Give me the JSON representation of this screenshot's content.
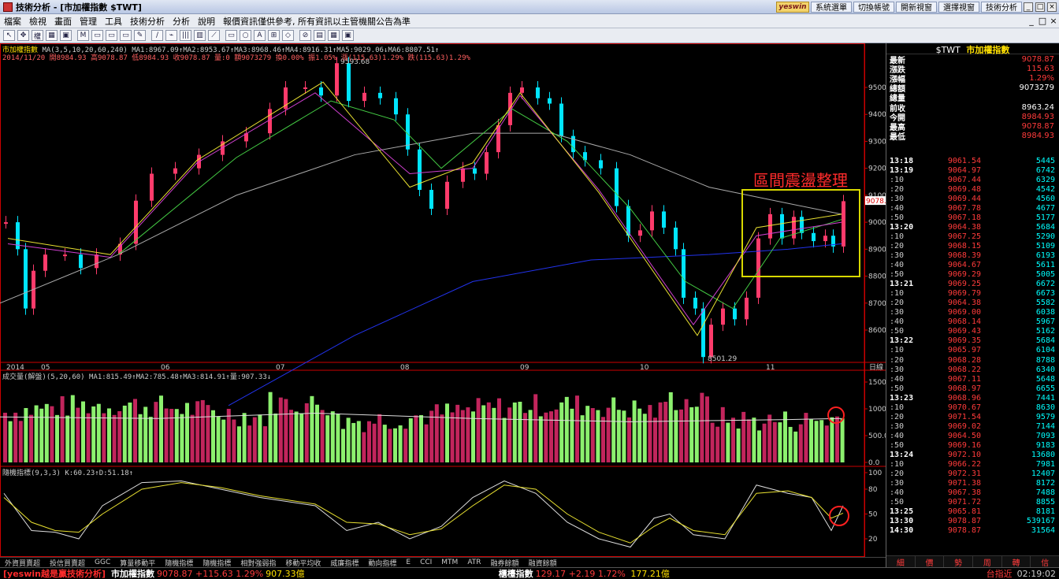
{
  "window": {
    "title": "技術分析 - [市加權指數 $TWT]",
    "brand": "yeswin",
    "top_buttons": [
      "系統選單",
      "切換帳號",
      "開新視窗",
      "選擇視窗",
      "技術分析"
    ],
    "controls": [
      "_",
      "□",
      "×"
    ]
  },
  "menu": {
    "items": [
      "檔案",
      "檢視",
      "畫面",
      "管理",
      "工具",
      "技術分析",
      "分析",
      "說明",
      "報價資訊僅供參考, 所有資訊以主管機關公告為準"
    ],
    "right_controls": [
      "_",
      "□",
      "×"
    ]
  },
  "toolbar": {
    "buttons": [
      "↖",
      "✥",
      "權",
      "▦",
      "▣",
      "M",
      "▭",
      "▭",
      "▭",
      "✎",
      "∕",
      "⌁",
      "|||",
      "▥",
      "⟋",
      "▭",
      "○",
      "A",
      "⊞",
      "◇",
      "⊘",
      "▤",
      "▦",
      "▣"
    ]
  },
  "chart": {
    "symbol_label": "市加權指數",
    "ma_line": "MA(3,5,10,20,60,240) MA1:8967.09↑MA2:8953.67↑MA3:8968.46↑MA4:8916.31↑MA5:9029.06↓MA6:8807.51↑",
    "ohlc_line": "2014/11/20 開8984.93 高9078.87 低8984.93 收9078.87 量:0 額9073279 換0.00% 振1.05% 漲(115.63)1.29% 跌(115.63)1.29%",
    "high_label": "9593.68",
    "low_label": "8501.29",
    "last_price_tag": "9078.9",
    "annotation": "區間震盪整理",
    "volume_legend": "成交量(解盤)(5,20,60) MA1:815.49↑MA2:785.48↑MA3:814.91↑量:907.33↓",
    "kd_legend": "隨機指標(9,3,3) K:60.23↑D:51.18↑",
    "price_axis": [
      "9500.0",
      "9400.0",
      "9300.0",
      "9200.0",
      "9100.0",
      "9000.0",
      "8900.0",
      "8800.0",
      "8700.0",
      "8600.0"
    ],
    "date_axis": [
      "2014",
      "05",
      "06",
      "07",
      "08",
      "09",
      "10",
      "11"
    ],
    "date_axis_right": "日線",
    "volume_axis": [
      "1500.0",
      "1000.0",
      "500.0",
      "0.0"
    ],
    "kd_axis": [
      "100",
      "80",
      "50",
      "20"
    ],
    "colors": {
      "up": "#ff3b6b",
      "down": "#00e5ff",
      "vol_up": "#c2255c",
      "vol_down": "#8cf06e",
      "ma_240": "#2233ee",
      "ma_60": "#aaaaaa",
      "box": "#d8d800",
      "mark": "#ff2020"
    }
  },
  "bottom_tabs": [
    "外資買賣超",
    "投信買賣超",
    "GGC",
    "算量移動平",
    "隨機指標",
    "隨機指標",
    "相對強弱指",
    "移動平均收",
    "威廉指標",
    "動向指標",
    "E",
    "CCI",
    "MTM",
    "ATR",
    "融券餘額",
    "融資餘額"
  ],
  "quote": {
    "symbol": "$TWT",
    "name": "市加權指數",
    "rows": [
      {
        "label": "最新",
        "value": "9078.87",
        "color": "#ff3b3b"
      },
      {
        "label": "漲跌",
        "value": "115.63",
        "color": "#ff3b3b"
      },
      {
        "label": "漲幅",
        "value": "1.29%",
        "color": "#ff3b3b"
      },
      {
        "label": "總額",
        "value": "9073279",
        "color": "#ffffff"
      },
      {
        "label": "總量",
        "value": "",
        "color": "#ffffff"
      },
      {
        "label": "前收",
        "value": "8963.24",
        "color": "#ffffff"
      },
      {
        "label": "今開",
        "value": "8984.93",
        "color": "#ff3b3b"
      },
      {
        "label": "最高",
        "value": "9078.87",
        "color": "#ff3b3b"
      },
      {
        "label": "最低",
        "value": "8984.93",
        "color": "#ff3b3b"
      }
    ],
    "ticks": [
      [
        "13:18",
        "9061.54",
        "5445"
      ],
      [
        "13:19",
        "9064.97",
        "6742"
      ],
      [
        ":10",
        "9067.44",
        "6329"
      ],
      [
        ":20",
        "9069.48",
        "4542"
      ],
      [
        ":30",
        "9069.44",
        "4560"
      ],
      [
        ":40",
        "9067.78",
        "4677"
      ],
      [
        ":50",
        "9067.18",
        "5177"
      ],
      [
        "13:20",
        "9064.38",
        "5684"
      ],
      [
        ":10",
        "9067.25",
        "5290"
      ],
      [
        ":20",
        "9068.15",
        "5109"
      ],
      [
        ":30",
        "9068.39",
        "6193"
      ],
      [
        ":40",
        "9064.67",
        "5611"
      ],
      [
        ":50",
        "9069.29",
        "5005"
      ],
      [
        "13:21",
        "9069.25",
        "6672"
      ],
      [
        ":10",
        "9069.79",
        "6673"
      ],
      [
        ":20",
        "9064.38",
        "5582"
      ],
      [
        ":30",
        "9069.00",
        "6038"
      ],
      [
        ":40",
        "9068.14",
        "5967"
      ],
      [
        ":50",
        "9069.43",
        "5162"
      ],
      [
        "13:22",
        "9069.35",
        "5684"
      ],
      [
        ":10",
        "9065.97",
        "6104"
      ],
      [
        ":20",
        "9068.28",
        "8788"
      ],
      [
        ":30",
        "9068.22",
        "6340"
      ],
      [
        ":40",
        "9067.11",
        "5648"
      ],
      [
        ":50",
        "9068.97",
        "6655"
      ],
      [
        "13:23",
        "9068.96",
        "7441"
      ],
      [
        ":10",
        "9070.67",
        "8630"
      ],
      [
        ":20",
        "9071.54",
        "9579"
      ],
      [
        ":30",
        "9069.02",
        "7144"
      ],
      [
        ":40",
        "9064.50",
        "7093"
      ],
      [
        ":50",
        "9069.16",
        "9183"
      ],
      [
        "13:24",
        "9072.10",
        "13680"
      ],
      [
        ":10",
        "9066.22",
        "7981"
      ],
      [
        ":20",
        "9072.31",
        "12407"
      ],
      [
        ":30",
        "9071.38",
        "8172"
      ],
      [
        ":40",
        "9067.38",
        "7488"
      ],
      [
        ":50",
        "9071.72",
        "8855"
      ],
      [
        "13:25",
        "9065.81",
        "8181"
      ],
      [
        "13:30",
        "9078.87",
        "539167"
      ],
      [
        "14:30",
        "9078.87",
        "31564"
      ]
    ],
    "tabs": [
      "細",
      "價",
      "勢",
      "周",
      "轉",
      "信"
    ]
  },
  "status": {
    "brand": "[yeswin越是贏技術分析]",
    "index_name": "市加權指數",
    "index_value": "9078.87",
    "index_change": "+115.63",
    "index_pct": "1.29%",
    "index_volume": "907.33億",
    "index2_name": "櫃檯指數",
    "index2_value": "129.17",
    "index2_change": "+2.19",
    "index2_pct": "1.72%",
    "index2_volume": "177.21億",
    "right_label": "台指近",
    "clock": "02:19:02"
  }
}
